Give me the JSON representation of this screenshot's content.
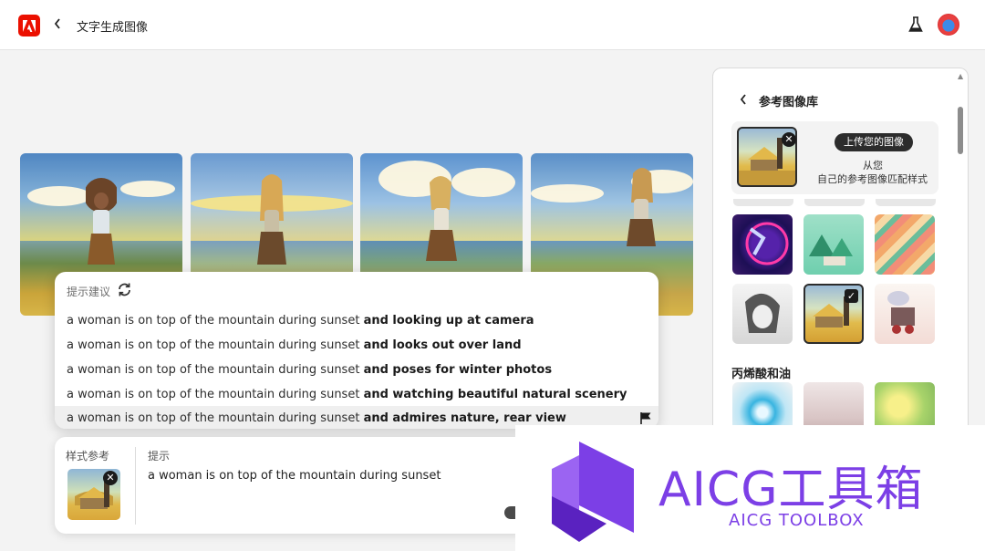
{
  "header": {
    "title": "文字生成图像"
  },
  "suggestions": {
    "heading": "提示建议",
    "items": [
      {
        "prefix": "a woman is on top of the mountain during sunset ",
        "suffix": "and looking up at camera"
      },
      {
        "prefix": "a woman is on top of the mountain during sunset ",
        "suffix": "and looks out over land"
      },
      {
        "prefix": "a woman is on top of the mountain during sunset ",
        "suffix": "and poses for winter photos"
      },
      {
        "prefix": "a woman is on top of the mountain during sunset ",
        "suffix": "and watching beautiful natural scenery"
      },
      {
        "prefix": "a woman is on top of the mountain during sunset ",
        "suffix": "and admires nature, rear view"
      }
    ]
  },
  "prompt_panel": {
    "style_ref_label": "样式参考",
    "prompt_label": "提示",
    "prompt_value": "a woman is on top of the mountain during sunset"
  },
  "ref_panel": {
    "title": "参考图像库",
    "upload_button": "上传您的图像",
    "upload_text_1": "从您",
    "upload_text_2": "自己的参考图像匹配样式",
    "section_title": "丙烯酸和油"
  },
  "watermark": {
    "title": "AICG工具箱",
    "subtitle": "AICG TOOLBOX"
  },
  "colors": {
    "brand": "#eb1000",
    "watermark": "#7c3fe6"
  }
}
